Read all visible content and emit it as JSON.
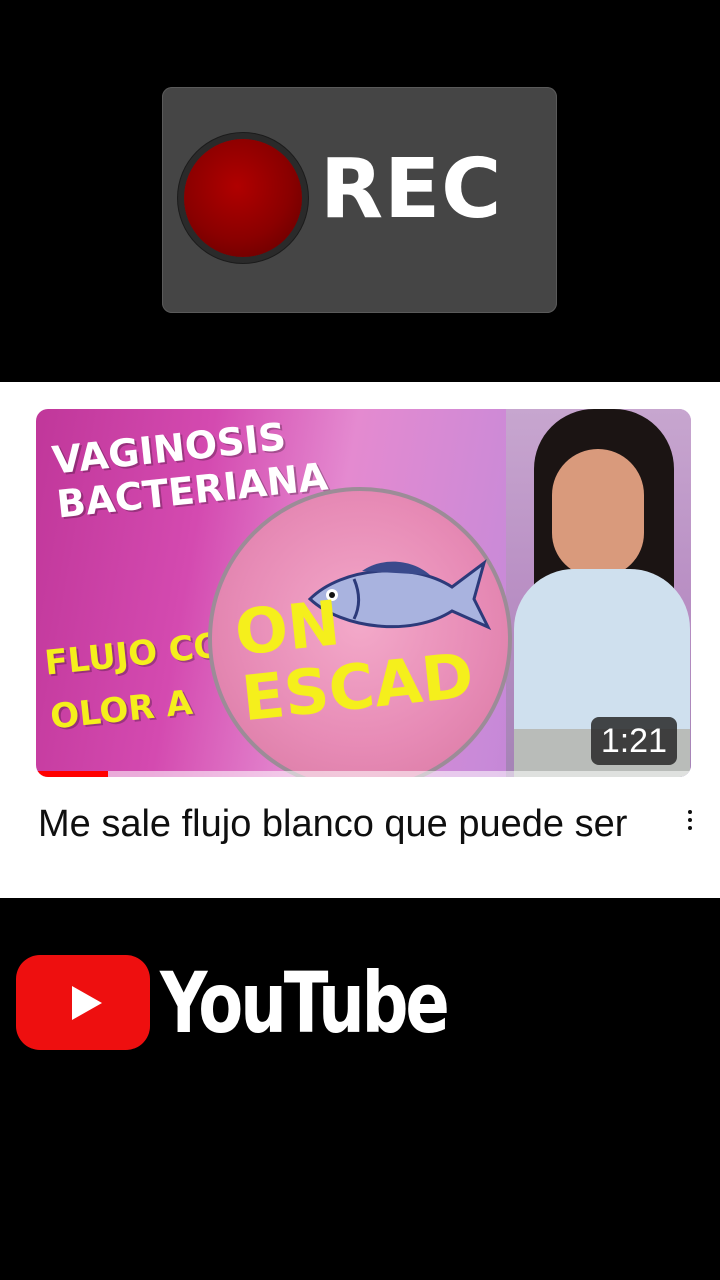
{
  "rec_badge": {
    "label": "REC"
  },
  "video": {
    "thumbnail": {
      "headline_line1": "VAGINOSIS",
      "headline_line2": "BACTERIANA",
      "yellow_line1": "FLUJO CON",
      "yellow_line2": "OLOR A",
      "magnified_text": "ON\nESCAD",
      "duration": "1:21",
      "watched_fraction": 0.11
    },
    "title": "Me sale flujo blanco que puede ser"
  },
  "logo": {
    "wordmark": "YouTube"
  },
  "colors": {
    "accent": "#ee0f0f",
    "progress": "#ff0000",
    "thumbnail_text_yellow": "#f5ef1c"
  }
}
